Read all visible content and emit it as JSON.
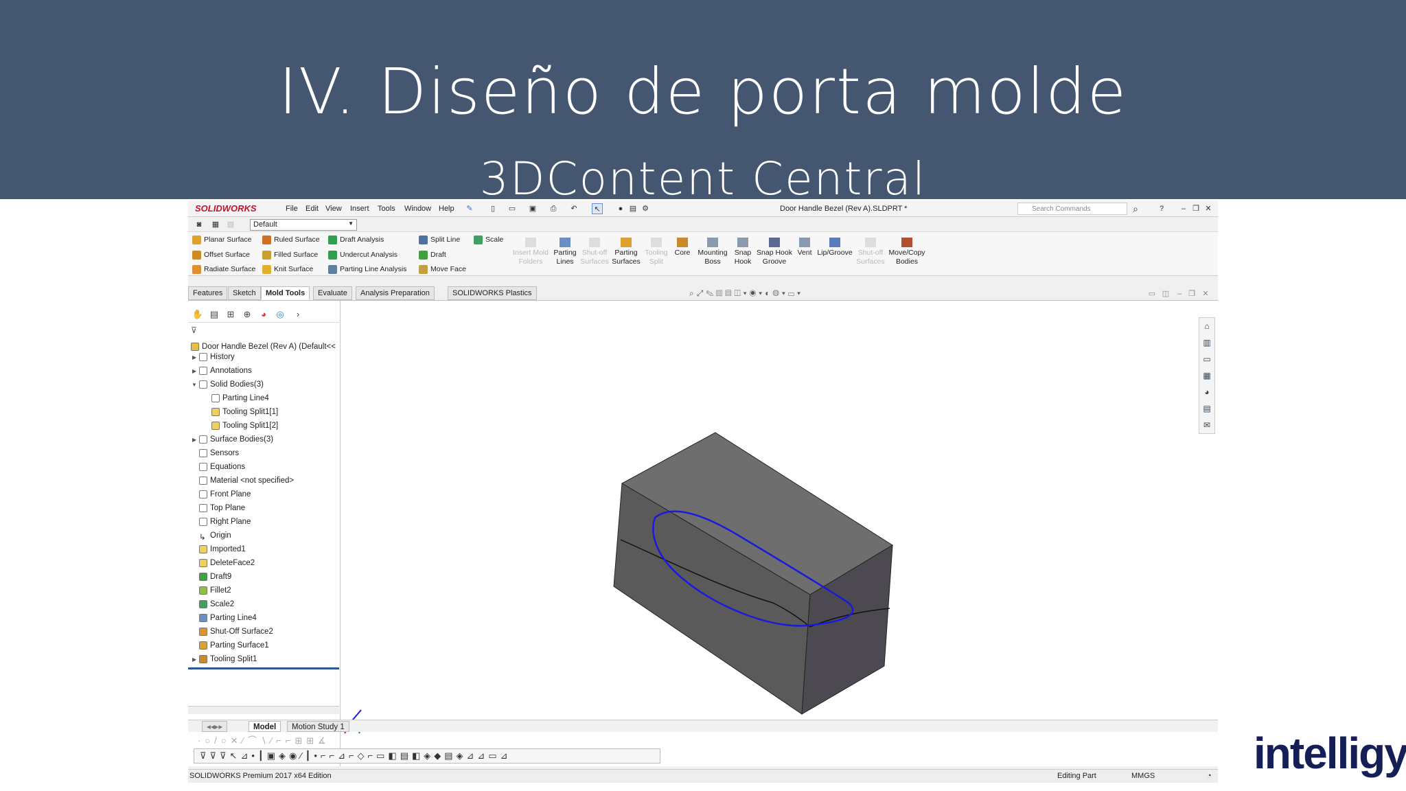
{
  "slide": {
    "title": "IV. Diseño de porta molde",
    "subtitle": "3DContent Central",
    "logo": "intelligy"
  },
  "app": {
    "logo": "SOLIDWORKS",
    "menu": [
      "File",
      "Edit",
      "View",
      "Insert",
      "Tools",
      "Window",
      "Help"
    ],
    "document_title": "Door Handle Bezel (Rev A).SLDPRT *",
    "search_placeholder": "Search Commands",
    "configuration": "Default",
    "commands_left": [
      {
        "label": "Planar Surface",
        "icon": "planar-surface-icon",
        "color": "#e0a030"
      },
      {
        "label": "Offset Surface",
        "icon": "offset-surface-icon",
        "color": "#d08a20"
      },
      {
        "label": "Radiate Surface",
        "icon": "radiate-surface-icon",
        "color": "#e09030"
      },
      {
        "label": "Ruled Surface",
        "icon": "ruled-surface-icon",
        "color": "#d07020"
      },
      {
        "label": "Filled Surface",
        "icon": "filled-surface-icon",
        "color": "#c8a030"
      },
      {
        "label": "Knit Surface",
        "icon": "knit-surface-icon",
        "color": "#e0b030"
      },
      {
        "label": "Draft Analysis",
        "icon": "draft-analysis-icon",
        "color": "#30a050"
      },
      {
        "label": "Undercut Analysis",
        "icon": "undercut-analysis-icon",
        "color": "#30a050"
      },
      {
        "label": "Parting Line Analysis",
        "icon": "parting-line-analysis-icon",
        "color": "#6080a0"
      },
      {
        "label": "Split Line",
        "icon": "split-line-icon",
        "color": "#5070a0"
      },
      {
        "label": "Draft",
        "icon": "draft-icon",
        "color": "#40a040"
      },
      {
        "label": "Move Face",
        "icon": "move-face-icon",
        "color": "#c0a040"
      },
      {
        "label": "Scale",
        "icon": "scale-icon",
        "color": "#40a060"
      }
    ],
    "commands_big": [
      {
        "label": "Insert Mold Folders",
        "enabled": false
      },
      {
        "label": "Parting Lines",
        "enabled": true
      },
      {
        "label": "Shut-off Surfaces",
        "enabled": false
      },
      {
        "label": "Parting Surfaces",
        "enabled": true
      },
      {
        "label": "Tooling Split",
        "enabled": false
      },
      {
        "label": "Core",
        "enabled": true
      },
      {
        "label": "Mounting Boss",
        "enabled": true
      },
      {
        "label": "Snap Hook",
        "enabled": true
      },
      {
        "label": "Snap Hook Groove",
        "enabled": true
      },
      {
        "label": "Vent",
        "enabled": true
      },
      {
        "label": "Lip/Groove",
        "enabled": true
      },
      {
        "label": "Shut-off Surfaces",
        "enabled": false
      },
      {
        "label": "Move/Copy Bodies",
        "enabled": true
      }
    ],
    "tabs": [
      "Features",
      "Sketch",
      "Mold Tools",
      "Evaluate",
      "Analysis Preparation",
      "SOLIDWORKS Plastics"
    ],
    "active_tab": "Mold Tools",
    "tree": {
      "root": "Door Handle Bezel (Rev A)  (Default<<",
      "items": [
        {
          "label": "History",
          "indent": 1,
          "expandable": true
        },
        {
          "label": "Annotations",
          "indent": 1,
          "expandable": true
        },
        {
          "label": "Solid Bodies(3)",
          "indent": 1,
          "expandable": true,
          "expanded": true
        },
        {
          "label": "Parting Line4",
          "indent": 2
        },
        {
          "label": "Tooling Split1[1]",
          "indent": 2
        },
        {
          "label": "Tooling Split1[2]",
          "indent": 2
        },
        {
          "label": "Surface Bodies(3)",
          "indent": 1,
          "expandable": true
        },
        {
          "label": "Sensors",
          "indent": 1
        },
        {
          "label": "Equations",
          "indent": 1
        },
        {
          "label": "Material <not specified>",
          "indent": 1
        },
        {
          "label": "Front Plane",
          "indent": 1
        },
        {
          "label": "Top Plane",
          "indent": 1
        },
        {
          "label": "Right Plane",
          "indent": 1
        },
        {
          "label": "Origin",
          "indent": 1
        },
        {
          "label": "Imported1",
          "indent": 1
        },
        {
          "label": "DeleteFace2",
          "indent": 1
        },
        {
          "label": "Draft9",
          "indent": 1
        },
        {
          "label": "Fillet2",
          "indent": 1
        },
        {
          "label": "Scale2",
          "indent": 1
        },
        {
          "label": "Parting Line4",
          "indent": 1
        },
        {
          "label": "Shut-Off Surface2",
          "indent": 1
        },
        {
          "label": "Parting Surface1",
          "indent": 1
        },
        {
          "label": "Tooling Split1",
          "indent": 1,
          "expandable": true
        }
      ]
    },
    "bottom_tabs": [
      "Model",
      "Motion Study 1"
    ],
    "status": {
      "edition": "SOLIDWORKS Premium 2017 x64 Edition",
      "mode": "Editing Part",
      "units": "MMGS"
    }
  }
}
